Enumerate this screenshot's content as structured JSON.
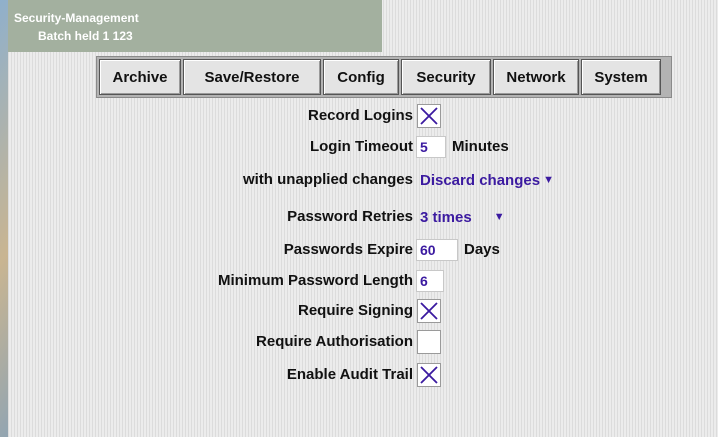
{
  "window": {
    "title": "Security-Management",
    "subtitle": "Batch held 1 123"
  },
  "tabs": [
    {
      "label": "Archive"
    },
    {
      "label": "Save/Restore"
    },
    {
      "label": "Config"
    },
    {
      "label": "Security"
    },
    {
      "label": "Network"
    },
    {
      "label": "System"
    }
  ],
  "form": {
    "record_logins": {
      "label": "Record Logins",
      "checked": true
    },
    "login_timeout": {
      "label": "Login Timeout",
      "value": "5",
      "unit": "Minutes"
    },
    "unapplied_changes": {
      "label": "with unapplied changes",
      "selected": "Discard changes"
    },
    "password_retries": {
      "label": "Password Retries",
      "selected": "3 times"
    },
    "passwords_expire": {
      "label": "Passwords Expire",
      "value": "60",
      "unit": "Days"
    },
    "min_password_length": {
      "label": "Minimum Password Length",
      "value": "6"
    },
    "require_signing": {
      "label": "Require Signing",
      "checked": true
    },
    "require_authorisation": {
      "label": "Require Authorisation",
      "checked": false
    },
    "enable_audit_trail": {
      "label": "Enable Audit Trail",
      "checked": true
    }
  },
  "colors": {
    "accent_text": "#3b1aa0",
    "titlebar": "#a3b09f",
    "panel": "#e6e6e6"
  },
  "icons": {
    "check_mark": "x-check-icon",
    "dropdown": "triangle-down-icon"
  }
}
